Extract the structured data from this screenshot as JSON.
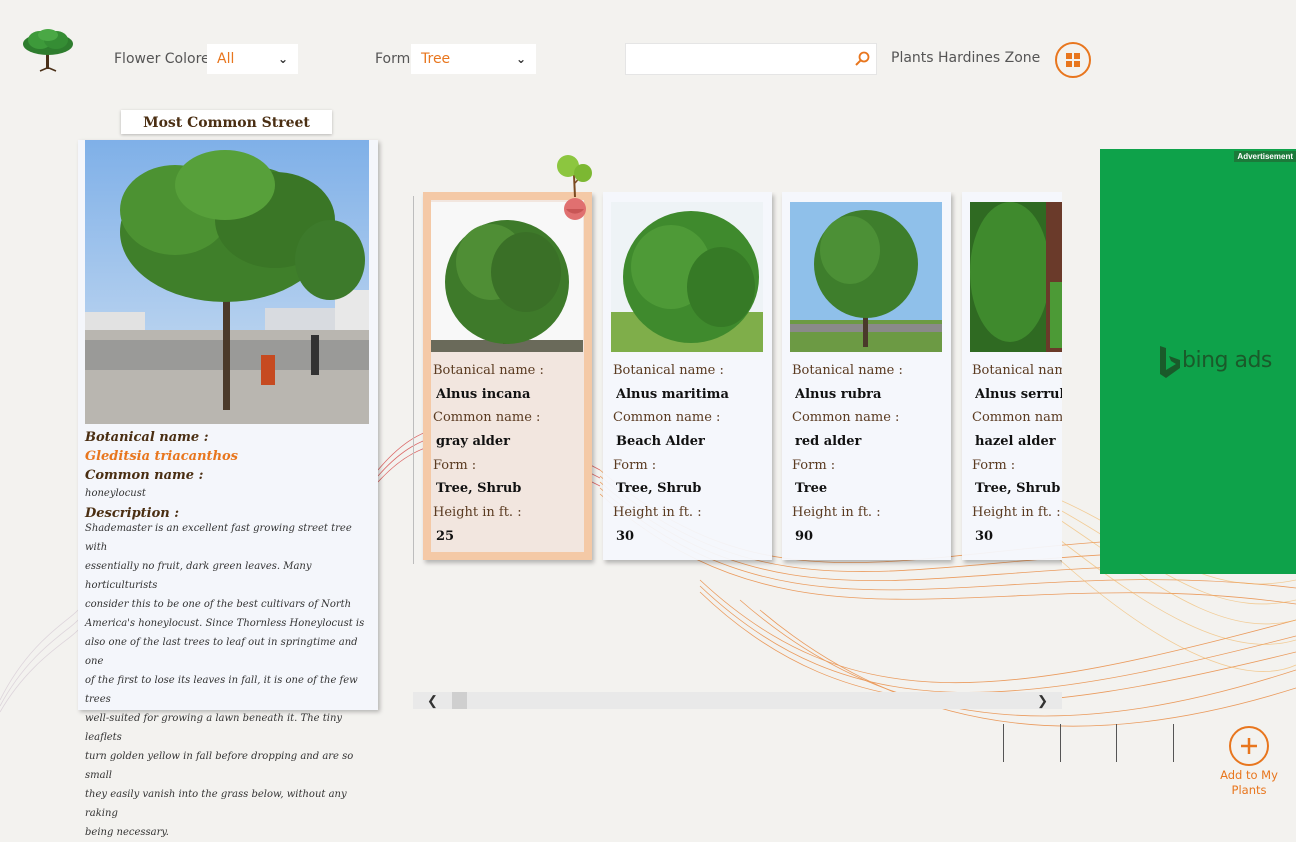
{
  "header": {
    "flower_label": "Flower Colore:",
    "flower_value": "All",
    "form_label": "Form",
    "form_value": "Tree",
    "search_placeholder": "",
    "zone_label": "Plants Hardines Zone"
  },
  "featured": {
    "title": "Most Common Street Trees",
    "botanical_label": "Botanical name :",
    "botanical_value": "Gleditsia triacanthos",
    "common_label": "Common name :",
    "common_value": "honeylocust",
    "description_label": "Description :",
    "description_lines": [
      "Shademaster is an excellent fast growing street tree with",
      "essentially no fruit, dark green leaves. Many horticulturists",
      "consider this to be one of the best cultivars of North",
      "America's honeylocust. Since Thornless Honeylocust is",
      "also one of the last trees to leaf out in springtime and one",
      "of the first to lose its leaves in fall, it is one of the few trees",
      "well-suited for growing a lawn beneath it. The tiny leaflets",
      "turn golden yellow in fall before dropping and are so small",
      "they easily vanish into the grass below, without any raking",
      "being necessary."
    ]
  },
  "cards": [
    {
      "botanical_label": "Botanical name :",
      "botanical": "Alnus incana",
      "common_label": "Common name :",
      "common": "gray alder",
      "form_label": "Form :",
      "form": "Tree, Shrub",
      "height_label": "Height in ft. :",
      "height": "25",
      "selected": true
    },
    {
      "botanical_label": "Botanical name :",
      "botanical": "Alnus maritima",
      "common_label": "Common name :",
      "common": "Beach Alder",
      "form_label": "Form :",
      "form": "Tree, Shrub",
      "height_label": "Height in ft. :",
      "height": "30",
      "selected": false
    },
    {
      "botanical_label": "Botanical name :",
      "botanical": "Alnus rubra",
      "common_label": "Common name :",
      "common": "red alder",
      "form_label": "Form :",
      "form": "Tree",
      "height_label": "Height in ft. :",
      "height": "90",
      "selected": false
    },
    {
      "botanical_label": "Botanical name :",
      "botanical": "Alnus serrulata",
      "common_label": "Common name :",
      "common": "hazel alder",
      "form_label": "Form :",
      "form": "Tree, Shrub",
      "height_label": "Height in ft. :",
      "height": "30",
      "selected": false
    }
  ],
  "ad": {
    "tag": "Advertisement",
    "brand": "bing ads",
    "background": "#0ea24a"
  },
  "footer": {
    "add_label_1": "Add to My",
    "add_label_2": "Plants"
  },
  "colors": {
    "accent": "#e8761e",
    "selected_card": "#f4c9a6"
  },
  "icons": {
    "logo": "tree-logo-icon",
    "search": "search-icon",
    "menu": "grid-icon",
    "add": "plus-icon",
    "pin": "tree-pin-icon"
  }
}
